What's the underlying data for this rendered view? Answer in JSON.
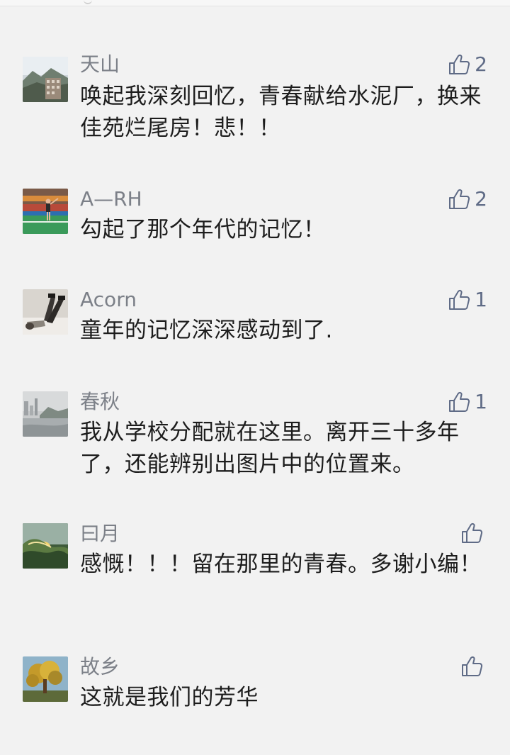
{
  "comments": [
    {
      "author": "天山",
      "text": "唤起我深刻回忆，青春献给水泥厂，换来佳苑烂尾房！悲！！",
      "likes": "2",
      "avatar_icon": "mountain-buildings-avatar"
    },
    {
      "author": "A—RH",
      "text": "勾起了那个年代的记忆！",
      "likes": "2",
      "avatar_icon": "badminton-court-avatar"
    },
    {
      "author": "Acorn",
      "text": "童年的记忆深深感动到了.",
      "likes": "1",
      "avatar_icon": "legs-up-avatar"
    },
    {
      "author": "春秋",
      "text": "我从学校分配就在这里。离开三十多年了，还能辨别出图片中的位置来。",
      "likes": "1",
      "avatar_icon": "river-city-avatar"
    },
    {
      "author": "曰月",
      "text": "感慨！！！留在那里的青春。多谢小编！",
      "likes": "",
      "avatar_icon": "sunset-wave-avatar"
    },
    {
      "author": "故乡",
      "text": "这就是我们的芳华",
      "likes": "",
      "avatar_icon": "tree-avatar"
    }
  ],
  "like_icon": "thumbs-up-icon",
  "colors": {
    "background": "#f2f2f2",
    "author": "#7c8088",
    "text": "#1d1d1d",
    "like": "#5f6b86"
  }
}
